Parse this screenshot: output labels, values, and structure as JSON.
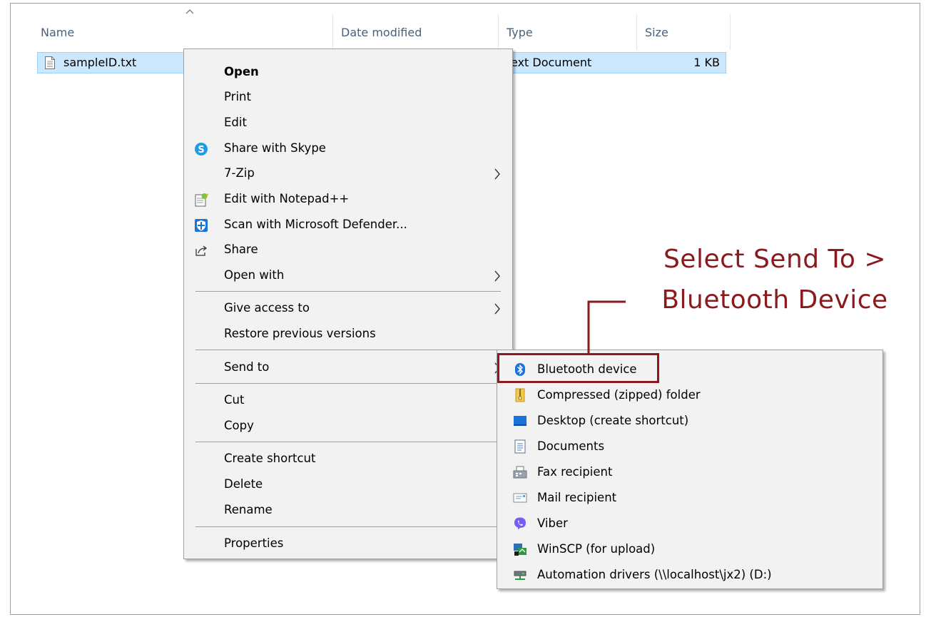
{
  "columns": {
    "name": "Name",
    "date_modified": "Date modified",
    "type": "Type",
    "size": "Size"
  },
  "file": {
    "name": "sampleID.txt",
    "type": "ext Document",
    "size": "1 KB",
    "icon": "text-file-icon"
  },
  "context_menu": {
    "open": "Open",
    "print": "Print",
    "edit": "Edit",
    "share_skype": "Share with Skype",
    "seven_zip": "7-Zip",
    "edit_notepad": "Edit with Notepad++",
    "scan_defender": "Scan with Microsoft Defender...",
    "share": "Share",
    "open_with": "Open with",
    "give_access": "Give access to",
    "restore_versions": "Restore previous versions",
    "send_to": "Send to",
    "cut": "Cut",
    "copy": "Copy",
    "create_shortcut": "Create shortcut",
    "delete": "Delete",
    "rename": "Rename",
    "properties": "Properties"
  },
  "send_to_menu": [
    {
      "label": "Bluetooth device",
      "icon": "bluetooth-icon"
    },
    {
      "label": "Compressed (zipped) folder",
      "icon": "zip-folder-icon"
    },
    {
      "label": "Desktop (create shortcut)",
      "icon": "desktop-icon"
    },
    {
      "label": "Documents",
      "icon": "documents-icon"
    },
    {
      "label": "Fax recipient",
      "icon": "fax-icon"
    },
    {
      "label": "Mail recipient",
      "icon": "mail-icon"
    },
    {
      "label": "Viber",
      "icon": "viber-icon"
    },
    {
      "label": "WinSCP (for upload)",
      "icon": "winscp-icon"
    },
    {
      "label": "Automation drivers (\\\\localhost\\jx2) (D:)",
      "icon": "network-drive-icon"
    }
  ],
  "callout": {
    "line1": "Select Send To >",
    "line2": "Bluetooth Device",
    "color": "#8b1a1f"
  },
  "colors": {
    "selection": "#cce8ff",
    "selection_border": "#99d1ff",
    "menu_bg": "#f2f2f2",
    "header_text": "#4c607a"
  }
}
